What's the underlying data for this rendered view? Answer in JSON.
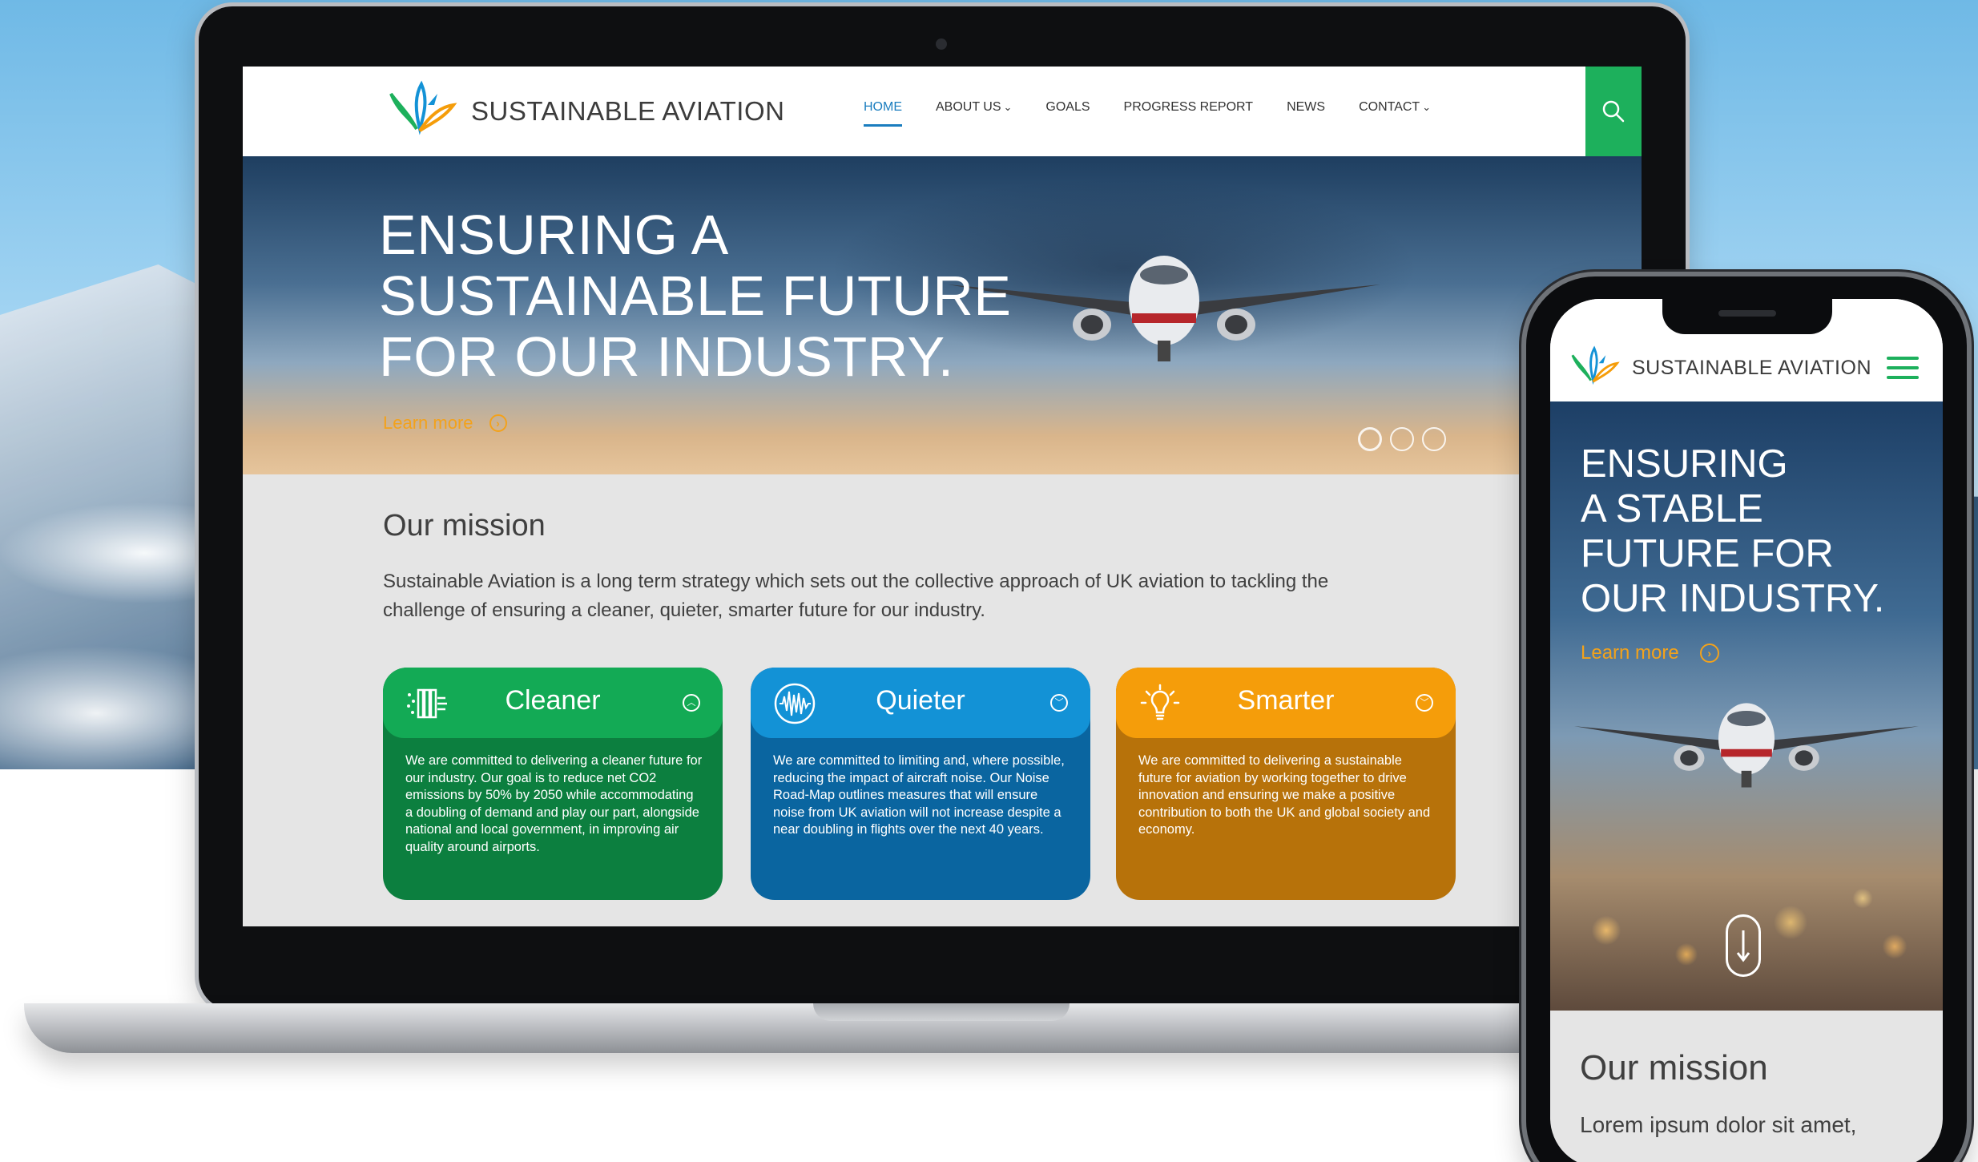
{
  "brand": {
    "name_bold": "SUSTAINABLE",
    "name_light": "AVIATION",
    "colors": {
      "green": "#13aa55",
      "blue": "#1392d6",
      "orange": "#f59d0a",
      "accent_text": "#f3a21b",
      "nav_active": "#1a7dbf"
    }
  },
  "laptop": {
    "nav": {
      "items": [
        {
          "label": "HOME",
          "active": true
        },
        {
          "label": "ABOUT US",
          "caret": "chevron-down-icon"
        },
        {
          "label": "GOALS",
          "caret": ""
        },
        {
          "label": "PROGRESS REPORT",
          "caret": ""
        },
        {
          "label": "NEWS",
          "caret": ""
        },
        {
          "label": "CONTACT",
          "caret": "chevron-down-icon"
        }
      ],
      "search_icon": "search-icon"
    },
    "hero": {
      "title": "ENSURING A\nSUSTAINABLE FUTURE\nFOR OUR INDUSTRY.",
      "learn_more": "Learn more",
      "slides": 3,
      "active_slide": 1
    },
    "mission": {
      "title": "Our mission",
      "text": "Sustainable Aviation is a long term strategy which sets out the collective approach of UK aviation to tackling the challenge of ensuring a cleaner, quieter, smarter future for our industry."
    },
    "cards": [
      {
        "title": "Cleaner",
        "icon": "air-filter-icon",
        "toggle": "chevron-up-icon",
        "body": "We are committed to delivering a cleaner future for our industry. Our goal is to reduce net CO2 emissions by 50% by 2050 while accommodating a doubling of demand and play our part, alongside national and local government, in improving air quality around airports."
      },
      {
        "title": "Quieter",
        "icon": "sound-wave-icon",
        "toggle": "chevron-down-icon",
        "body": "We are committed to limiting and, where possible, reducing the impact of aircraft noise. Our Noise Road-Map outlines measures that will ensure noise from UK aviation will not increase despite a near doubling in flights over the next 40 years."
      },
      {
        "title": "Smarter",
        "icon": "lightbulb-icon",
        "toggle": "chevron-down-icon",
        "body": "We are committed to delivering a sustainable future for aviation by working together to drive innovation and ensuring we make a positive contribution to both the UK and global society and economy."
      }
    ]
  },
  "phone": {
    "menu_icon": "hamburger-menu-icon",
    "hero": {
      "title": "ENSURING\nA STABLE\nFUTURE FOR\nOUR INDUSTRY.",
      "learn_more": "Learn more",
      "scroll_icon": "arrow-down-icon"
    },
    "mission": {
      "title": "Our mission",
      "text": "Lorem ipsum dolor sit amet,"
    }
  }
}
